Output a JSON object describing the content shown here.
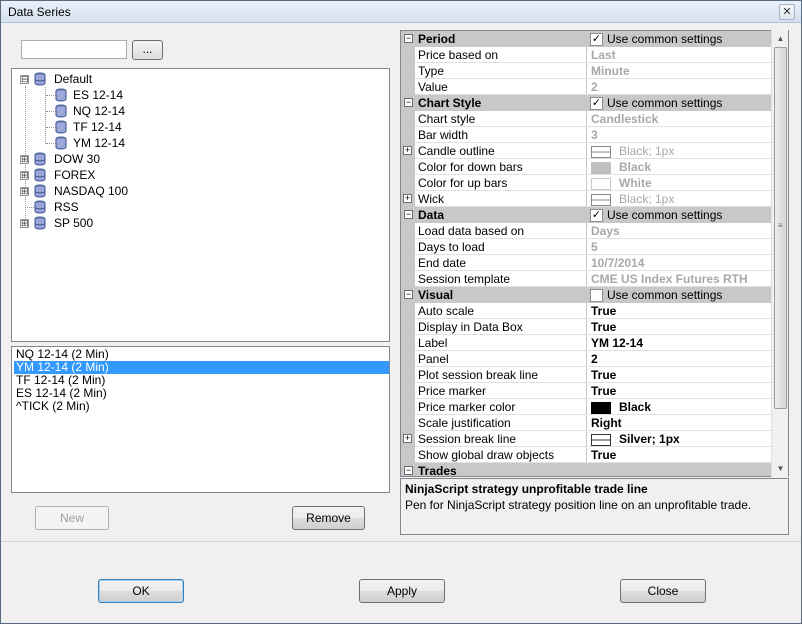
{
  "window": {
    "title": "Data Series",
    "close_glyph": "✕"
  },
  "left": {
    "search": {
      "value": "",
      "placeholder": ""
    },
    "browse_label": "...",
    "tree": [
      {
        "label": "Default",
        "expanded": true,
        "children": [
          "ES 12-14",
          "NQ 12-14",
          "TF 12-14",
          "YM 12-14"
        ]
      },
      {
        "label": "DOW 30",
        "expanded": false
      },
      {
        "label": "FOREX",
        "expanded": false
      },
      {
        "label": "NASDAQ 100",
        "expanded": false
      },
      {
        "label": "RSS",
        "expanded": false
      },
      {
        "label": "SP 500",
        "expanded": false
      }
    ],
    "series": [
      {
        "label": "NQ 12-14 (2 Min)",
        "selected": false
      },
      {
        "label": "YM 12-14 (2 Min)",
        "selected": true
      },
      {
        "label": "TF 12-14 (2 Min)",
        "selected": false
      },
      {
        "label": "ES 12-14 (2 Min)",
        "selected": false
      },
      {
        "label": "^TICK (2 Min)",
        "selected": false
      }
    ],
    "new_label": "New",
    "remove_label": "Remove"
  },
  "grid": {
    "period": {
      "name": "Period",
      "common_label": "Use common settings",
      "common_checked": true,
      "rows": [
        {
          "name": "Price based on",
          "value": "Last"
        },
        {
          "name": "Type",
          "value": "Minute"
        },
        {
          "name": "Value",
          "value": "2"
        }
      ]
    },
    "chart_style": {
      "name": "Chart Style",
      "common_label": "Use common settings",
      "common_checked": true,
      "rows": [
        {
          "name": "Chart style",
          "value": "Candlestick"
        },
        {
          "name": "Bar width",
          "value": "3"
        },
        {
          "name": "Candle outline",
          "value": "Black; 1px"
        },
        {
          "name": "Color for down bars",
          "value": "Black"
        },
        {
          "name": "Color for up bars",
          "value": "White"
        },
        {
          "name": "Wick",
          "value": "Black; 1px"
        }
      ]
    },
    "data": {
      "name": "Data",
      "common_label": "Use common settings",
      "common_checked": true,
      "rows": [
        {
          "name": "Load data based on",
          "value": "Days"
        },
        {
          "name": "Days to load",
          "value": "5"
        },
        {
          "name": "End date",
          "value": "10/7/2014"
        },
        {
          "name": "Session template",
          "value": "CME US Index Futures RTH"
        }
      ]
    },
    "visual": {
      "name": "Visual",
      "common_label": "Use common settings",
      "common_checked": false,
      "rows": [
        {
          "name": "Auto scale",
          "value": "True"
        },
        {
          "name": "Display in Data Box",
          "value": "True"
        },
        {
          "name": "Label",
          "value": "YM 12-14"
        },
        {
          "name": "Panel",
          "value": "2"
        },
        {
          "name": "Plot session break line",
          "value": "True"
        },
        {
          "name": "Price marker",
          "value": "True"
        },
        {
          "name": "Price marker color",
          "value": "Black"
        },
        {
          "name": "Scale justification",
          "value": "Right"
        },
        {
          "name": "Session break line",
          "value": "Silver; 1px"
        },
        {
          "name": "Show global draw objects",
          "value": "True"
        }
      ]
    },
    "trades": {
      "name": "Trades"
    }
  },
  "description": {
    "title": "NinjaScript strategy unprofitable trade line",
    "text": "Pen for NinjaScript strategy position line on an unprofitable trade."
  },
  "buttons": {
    "ok": "OK",
    "apply": "Apply",
    "close": "Close"
  },
  "colors": {
    "selection": "#3399ff",
    "category_bg": "#c8c8c8",
    "black_swatch": "#000000",
    "down_bars": "#c0c0c0",
    "up_bars": "#ffffff"
  },
  "icons": {
    "collapse": "⊟",
    "expand": "⊞",
    "check": "✓",
    "database": "database-icon"
  }
}
